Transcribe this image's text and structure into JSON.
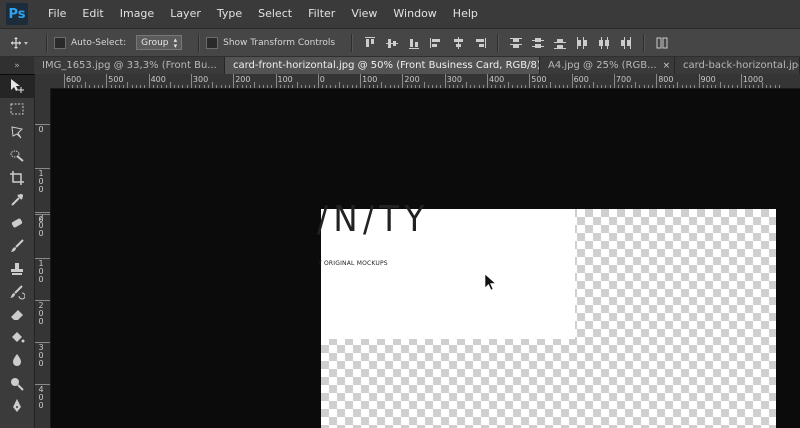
{
  "app": {
    "logo": "Ps"
  },
  "menu": [
    "File",
    "Edit",
    "Image",
    "Layer",
    "Type",
    "Select",
    "Filter",
    "View",
    "Window",
    "Help"
  ],
  "options": {
    "auto_select_label": "Auto-Select:",
    "auto_select_value": "Group",
    "show_transform_label": "Show Transform Controls"
  },
  "tabs": [
    {
      "label": "IMG_1653.jpg @ 33,3% (Front Bu...",
      "active": false
    },
    {
      "label": "card-front-horizontal.jpg @ 50% (Front Business Card, RGB/8) *",
      "active": true
    },
    {
      "label": "A4.jpg @ 25% (RGB...",
      "active": false
    },
    {
      "label": "card-back-horizontal.jpg @ 10",
      "active": false
    }
  ],
  "ruler_top_labels": [
    "600",
    "500",
    "400",
    "300",
    "200",
    "100",
    "0",
    "100",
    "200",
    "300",
    "400",
    "500",
    "600",
    "700",
    "800",
    "900",
    "1000"
  ],
  "ruler_left_labels": [
    "0",
    "100",
    "200",
    "0",
    "100",
    "200",
    "300",
    "400"
  ],
  "document": {
    "title_text": "/N/TY",
    "subtitle_text": "Y ORIGINAL MOCKUPS"
  },
  "tools": [
    "move-tool-icon",
    "marquee-tool-icon",
    "lasso-tool-icon",
    "quick-select-tool-icon",
    "crop-tool-icon",
    "eyedropper-tool-icon",
    "healing-brush-tool-icon",
    "brush-tool-icon",
    "clone-stamp-tool-icon",
    "history-brush-tool-icon",
    "eraser-tool-icon",
    "paint-bucket-tool-icon",
    "blur-tool-icon",
    "dodge-tool-icon",
    "pen-tool-icon"
  ]
}
